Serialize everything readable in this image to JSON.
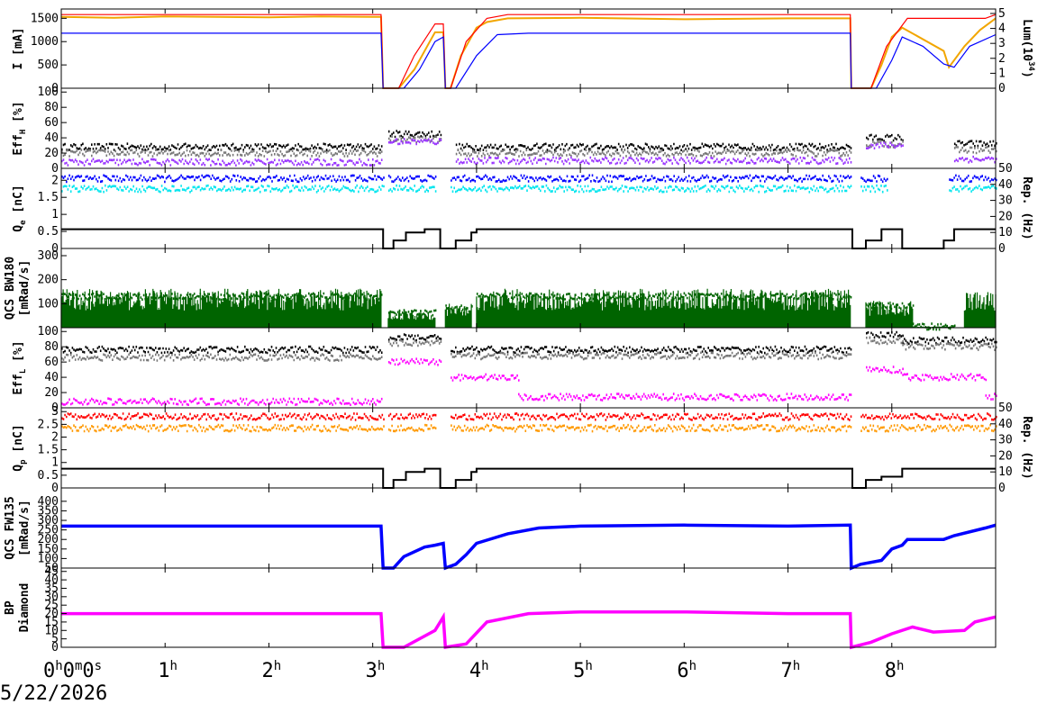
{
  "time_axis": {
    "start_label": [
      "0",
      "h",
      "0",
      "m",
      "0",
      "s"
    ],
    "hour_labels": [
      {
        "n": "1",
        "u": "h"
      },
      {
        "n": "2",
        "u": "h"
      },
      {
        "n": "3",
        "u": "h"
      },
      {
        "n": "4",
        "u": "h"
      },
      {
        "n": "5",
        "u": "h"
      },
      {
        "n": "6",
        "u": "h"
      },
      {
        "n": "7",
        "u": "h"
      },
      {
        "n": "8",
        "u": "h"
      }
    ],
    "date": "5/22/2026",
    "range_hours": [
      0,
      9.0
    ]
  },
  "colors": {
    "orange": "#f2a600",
    "red": "#ff0000",
    "blue": "#0000ff",
    "black": "#000000",
    "grey": "#777777",
    "purple": "#9933ff",
    "cyan": "#00e5ee",
    "darkgreen": "#006400",
    "magenta": "#ff00ff",
    "orange2": "#ff9900"
  },
  "chart_data": [
    {
      "type": "line",
      "panel": "current",
      "ylabel": [
        "I [mA]"
      ],
      "y2label": "Lum(10^34)",
      "y2label_parts": [
        "Lum(10",
        "34",
        ")"
      ],
      "ylim": [
        0,
        1700
      ],
      "yticks": [
        "0",
        "500",
        "1000",
        "1500"
      ],
      "y2lim": [
        0,
        5.3
      ],
      "y2ticks": [
        "0",
        "1",
        "2",
        "3",
        "4",
        "5"
      ],
      "series": [
        {
          "color": "orange",
          "x": [
            0,
            0.5,
            1,
            1.5,
            2,
            2.5,
            3,
            3.08,
            3.1,
            3.25,
            3.4,
            3.55,
            3.6,
            3.68,
            3.7,
            3.75,
            3.85,
            4.0,
            4.1,
            4.3,
            5,
            6,
            7,
            7.6,
            7.61,
            7.8,
            7.9,
            8.0,
            8.1,
            8.5,
            8.55,
            8.7,
            8.85,
            9.0
          ],
          "y": [
            1530,
            1510,
            1540,
            1530,
            1520,
            1540,
            1530,
            1530,
            0,
            0,
            400,
            1000,
            1200,
            1200,
            0,
            0,
            700,
            1300,
            1420,
            1500,
            1510,
            1480,
            1500,
            1500,
            0,
            0,
            500,
            1100,
            1300,
            800,
            450,
            900,
            1250,
            1500
          ]
        },
        {
          "color": "red",
          "x": [
            0,
            3.08,
            3.1,
            3.25,
            3.4,
            3.6,
            3.68,
            3.7,
            3.75,
            3.9,
            4.1,
            4.3,
            5,
            7.6,
            7.61,
            7.8,
            7.95,
            8.15,
            8.9,
            9.0
          ],
          "y": [
            1580,
            1580,
            0,
            0,
            700,
            1380,
            1380,
            0,
            0,
            1000,
            1500,
            1580,
            1580,
            1580,
            0,
            0,
            900,
            1500,
            1500,
            1580
          ]
        },
        {
          "color": "blue",
          "x": [
            0,
            3.08,
            3.1,
            3.3,
            3.45,
            3.6,
            3.68,
            3.7,
            3.8,
            4.0,
            4.2,
            4.5,
            7.6,
            7.61,
            7.85,
            8.0,
            8.1,
            8.3,
            8.5,
            8.6,
            8.75,
            9.0
          ],
          "y": [
            1180,
            1180,
            0,
            0,
            400,
            1000,
            1100,
            0,
            0,
            700,
            1150,
            1180,
            1180,
            0,
            0,
            600,
            1100,
            900,
            520,
            450,
            900,
            1150
          ]
        }
      ]
    },
    {
      "type": "scatter",
      "panel": "effH",
      "ylabel": [
        "Eff",
        "H",
        " [%]"
      ],
      "ylim": [
        0,
        105
      ],
      "yticks": [
        "0",
        "20",
        "40",
        "60",
        "80",
        "100"
      ],
      "series": [
        {
          "color": "black",
          "segments": [
            [
              0,
              3.08,
              28
            ],
            [
              3.15,
              3.65,
              45
            ],
            [
              3.8,
              7.6,
              28
            ],
            [
              7.75,
              8.1,
              40
            ],
            [
              8.6,
              9.0,
              32
            ]
          ]
        },
        {
          "color": "grey",
          "segments": [
            [
              0,
              3.08,
              20
            ],
            [
              3.15,
              3.65,
              38
            ],
            [
              3.8,
              7.6,
              20
            ],
            [
              7.75,
              8.1,
              32
            ],
            [
              8.6,
              9.0,
              24
            ]
          ]
        },
        {
          "color": "purple",
          "segments": [
            [
              0,
              3.08,
              8
            ],
            [
              3.15,
              3.65,
              35
            ],
            [
              3.8,
              7.6,
              10
            ],
            [
              7.75,
              8.1,
              30
            ],
            [
              8.6,
              9.0,
              12
            ]
          ]
        }
      ]
    },
    {
      "type": "scatter",
      "panel": "qe",
      "ylabel": [
        "Q",
        "e",
        " [nC]"
      ],
      "y2label": "Rep. (Hz)",
      "ylim": [
        0,
        2.35
      ],
      "yticks": [
        "0",
        "0.5",
        "1",
        "1.5",
        "2"
      ],
      "y2lim": [
        0,
        50
      ],
      "y2ticks": [
        "0",
        "10",
        "20",
        "30",
        "40",
        "50"
      ],
      "series": [
        {
          "color": "blue",
          "segments": [
            [
              0,
              3.1,
              2.05
            ],
            [
              3.15,
              3.6,
              2.05
            ],
            [
              3.75,
              7.6,
              2.05
            ],
            [
              7.7,
              7.95,
              2.05
            ],
            [
              8.55,
              9.0,
              2.05
            ]
          ]
        },
        {
          "color": "cyan",
          "segments": [
            [
              0,
              3.1,
              1.75
            ],
            [
              3.15,
              3.6,
              1.75
            ],
            [
              3.75,
              7.6,
              1.75
            ],
            [
              7.7,
              7.95,
              1.75
            ],
            [
              8.55,
              9.0,
              1.75
            ]
          ]
        }
      ],
      "rep_line": {
        "x": [
          0,
          3.1,
          3.1,
          3.2,
          3.2,
          3.32,
          3.32,
          3.5,
          3.5,
          3.65,
          3.65,
          3.8,
          3.8,
          3.95,
          3.95,
          4.0,
          4.0,
          7.62,
          7.62,
          7.75,
          7.75,
          7.9,
          7.9,
          8.1,
          8.1,
          8.5,
          8.5,
          8.6,
          8.6,
          9.0
        ],
        "y": [
          12,
          12,
          0,
          0,
          5,
          5,
          10,
          10,
          12,
          12,
          0,
          0,
          5,
          5,
          10,
          10,
          12,
          12,
          0,
          0,
          5,
          5,
          12,
          12,
          0,
          0,
          5,
          5,
          12,
          12
        ]
      }
    },
    {
      "type": "area",
      "panel": "qcs_bw",
      "ylabel": [
        "QCS BW180",
        "[mRad/s]"
      ],
      "ylim": [
        0,
        330
      ],
      "yticks": [
        "100",
        "200",
        "300"
      ],
      "series": [
        {
          "color": "darkgreen",
          "segments": [
            [
              0,
              3.08,
              130
            ],
            [
              3.15,
              3.6,
              60
            ],
            [
              3.7,
              3.95,
              80
            ],
            [
              4.0,
              7.6,
              130
            ],
            [
              7.75,
              8.2,
              90
            ],
            [
              8.2,
              8.6,
              5
            ],
            [
              8.7,
              9.0,
              120
            ]
          ]
        }
      ]
    },
    {
      "type": "scatter",
      "panel": "effL",
      "ylabel": [
        "Eff",
        "L",
        " [%]"
      ],
      "ylim": [
        0,
        105
      ],
      "yticks": [
        "0",
        "20",
        "40",
        "60",
        "80",
        "100"
      ],
      "series": [
        {
          "color": "black",
          "segments": [
            [
              0,
              3.08,
              76
            ],
            [
              3.15,
              3.65,
              92
            ],
            [
              3.75,
              7.6,
              76
            ],
            [
              7.75,
              8.1,
              95
            ],
            [
              8.1,
              9.0,
              88
            ]
          ]
        },
        {
          "color": "grey",
          "segments": [
            [
              0,
              3.08,
              66
            ],
            [
              3.15,
              3.65,
              85
            ],
            [
              3.75,
              7.6,
              68
            ],
            [
              7.75,
              8.1,
              88
            ],
            [
              8.1,
              9.0,
              80
            ]
          ]
        },
        {
          "color": "magenta",
          "segments": [
            [
              0,
              3.08,
              8
            ],
            [
              3.15,
              3.65,
              60
            ],
            [
              3.75,
              4.4,
              40
            ],
            [
              4.4,
              7.6,
              14
            ],
            [
              7.75,
              8.1,
              50
            ],
            [
              8.1,
              8.9,
              40
            ],
            [
              8.9,
              9.0,
              15
            ]
          ]
        }
      ]
    },
    {
      "type": "scatter",
      "panel": "qp",
      "ylabel": [
        "Q",
        "p",
        " [nC]"
      ],
      "y2label": "Rep. (Hz)",
      "ylim": [
        0,
        3.15
      ],
      "yticks": [
        "0",
        "0.5",
        "1",
        "1.5",
        "2",
        "2.5",
        "3"
      ],
      "y2lim": [
        0,
        50
      ],
      "y2ticks": [
        "0",
        "10",
        "20",
        "30",
        "40",
        "50"
      ],
      "series": [
        {
          "color": "red",
          "segments": [
            [
              0,
              3.1,
              2.8
            ],
            [
              3.15,
              3.6,
              2.8
            ],
            [
              3.75,
              7.6,
              2.8
            ],
            [
              7.7,
              9.0,
              2.8
            ]
          ]
        },
        {
          "color": "orange2",
          "segments": [
            [
              0,
              3.1,
              2.35
            ],
            [
              3.15,
              3.6,
              2.35
            ],
            [
              3.75,
              7.6,
              2.35
            ],
            [
              7.7,
              9.0,
              2.35
            ]
          ]
        }
      ],
      "rep_line": {
        "x": [
          0,
          3.1,
          3.1,
          3.2,
          3.2,
          3.32,
          3.32,
          3.5,
          3.5,
          3.65,
          3.65,
          3.8,
          3.8,
          3.95,
          3.95,
          4.0,
          4.0,
          7.62,
          7.62,
          7.75,
          7.75,
          7.9,
          7.9,
          8.1,
          8.1,
          9.0
        ],
        "y": [
          12,
          12,
          0,
          0,
          5,
          5,
          10,
          10,
          12,
          12,
          0,
          0,
          5,
          5,
          10,
          10,
          12,
          12,
          0,
          0,
          5,
          5,
          7,
          7,
          12,
          12
        ]
      }
    },
    {
      "type": "area",
      "panel": "qcs_fw",
      "ylabel": [
        "QCS FW135",
        "[mRad/s]"
      ],
      "ylim": [
        50,
        470
      ],
      "yticks": [
        "50",
        "100",
        "150",
        "200",
        "250",
        "300",
        "350",
        "400"
      ],
      "series": [
        {
          "color": "blue",
          "x": [
            0,
            3.08,
            3.1,
            3.2,
            3.3,
            3.5,
            3.6,
            3.68,
            3.7,
            3.8,
            3.9,
            4.0,
            4.3,
            4.6,
            5,
            6,
            7,
            7.6,
            7.61,
            7.7,
            7.9,
            8.0,
            8.1,
            8.15,
            8.5,
            8.6,
            8.9,
            9.0
          ],
          "y": [
            270,
            270,
            50,
            50,
            110,
            160,
            170,
            180,
            50,
            70,
            120,
            180,
            230,
            260,
            270,
            275,
            270,
            275,
            50,
            70,
            90,
            150,
            170,
            200,
            200,
            220,
            260,
            275
          ]
        }
      ]
    },
    {
      "type": "area",
      "panel": "bp",
      "ylabel": [
        "BP",
        "Diamond"
      ],
      "ylim": [
        0,
        47
      ],
      "yticks": [
        "0",
        "5",
        "10",
        "15",
        "20",
        "25",
        "30",
        "35",
        "40",
        "45"
      ],
      "series": [
        {
          "color": "magenta",
          "x": [
            0,
            3.08,
            3.1,
            3.3,
            3.6,
            3.68,
            3.7,
            3.9,
            4.1,
            4.5,
            5,
            6,
            7,
            7.6,
            7.61,
            7.8,
            8.0,
            8.2,
            8.4,
            8.7,
            8.8,
            9.0
          ],
          "y": [
            20,
            20,
            0,
            0,
            10,
            18,
            0,
            2,
            15,
            20,
            21,
            21,
            20,
            20,
            0,
            3,
            8,
            12,
            9,
            10,
            15,
            18
          ]
        }
      ]
    }
  ]
}
